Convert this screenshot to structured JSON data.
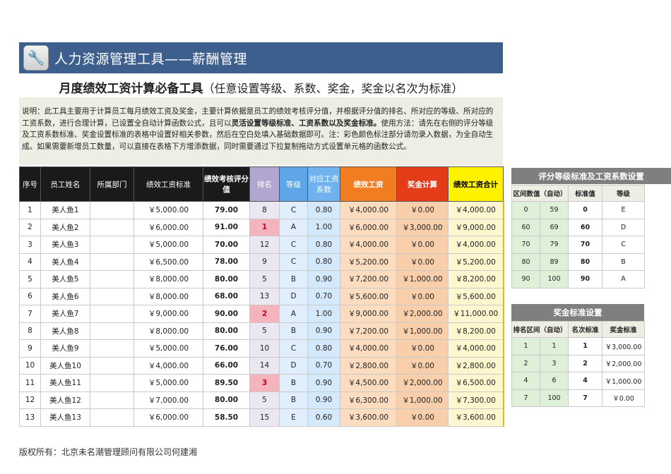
{
  "banner": {
    "icon": "wrench-icon",
    "title": "人力资源管理工具——薪酬管理"
  },
  "subtitle": {
    "main": "月度绩效工资计算必备工具",
    "note": "（任意设置等级、系数、奖金，奖金以名次为标准）"
  },
  "description": {
    "part1": "说明：此工具主要用于计算员工每月绩效工资及奖金，主要计算依据是员工的绩效考核评分值，并根据评分值的排名、所对应的等级、所对应的工资系数，进行合理计算，已设置全自动计算函数公式，且可以",
    "bold": "灵活设置等级标准、工资系数以及奖金标准。",
    "part2": "使用方法：请先在右侧的评分等级及工资系数标准、奖金设置标准的表格中设置好相关参数，然后在空白处填入基础数据即可。注：彩色颜色标注部分请勿录入数据，为全自动生成。如果需要新增员工数量，可以直接在表格下方增添数据，同时需要通过下拉复制拖动方式设置单元格的函数公式。"
  },
  "main_table": {
    "headers": [
      "序号",
      "员工姓名",
      "所属部门",
      "绩效工资标准",
      "绩效考核评分值",
      "排名",
      "等级",
      "对应工资系数",
      "绩效工资",
      "奖金计算",
      "绩效工资合计"
    ],
    "rows": [
      [
        "1",
        "美人鱼1",
        "",
        "￥5,000.00",
        "79.00",
        "8",
        "C",
        "0.80",
        "￥4,000.00",
        "￥0.00",
        "￥4,000.00"
      ],
      [
        "2",
        "美人鱼2",
        "",
        "￥6,000.00",
        "91.00",
        "1",
        "A",
        "1.00",
        "￥6,000.00",
        "￥3,000.00",
        "￥9,000.00"
      ],
      [
        "3",
        "美人鱼3",
        "",
        "￥5,000.00",
        "70.00",
        "12",
        "C",
        "0.80",
        "￥4,000.00",
        "￥0.00",
        "￥4,000.00"
      ],
      [
        "4",
        "美人鱼4",
        "",
        "￥6,500.00",
        "78.00",
        "9",
        "C",
        "0.80",
        "￥5,200.00",
        "￥0.00",
        "￥5,200.00"
      ],
      [
        "5",
        "美人鱼5",
        "",
        "￥8,000.00",
        "80.00",
        "5",
        "B",
        "0.90",
        "￥7,200.00",
        "￥1,000.00",
        "￥8,200.00"
      ],
      [
        "6",
        "美人鱼6",
        "",
        "￥8,000.00",
        "68.00",
        "13",
        "D",
        "0.70",
        "￥5,600.00",
        "￥0.00",
        "￥5,600.00"
      ],
      [
        "7",
        "美人鱼7",
        "",
        "￥9,000.00",
        "90.00",
        "2",
        "A",
        "1.00",
        "￥9,000.00",
        "￥2,000.00",
        "￥11,000.00"
      ],
      [
        "8",
        "美人鱼8",
        "",
        "￥8,000.00",
        "80.00",
        "5",
        "B",
        "0.90",
        "￥7,200.00",
        "￥1,000.00",
        "￥8,200.00"
      ],
      [
        "9",
        "美人鱼9",
        "",
        "￥5,000.00",
        "76.00",
        "10",
        "C",
        "0.80",
        "￥4,000.00",
        "￥0.00",
        "￥4,000.00"
      ],
      [
        "10",
        "美人鱼10",
        "",
        "￥4,000.00",
        "66.00",
        "14",
        "D",
        "0.70",
        "￥2,800.00",
        "￥0.00",
        "￥2,800.00"
      ],
      [
        "11",
        "美人鱼11",
        "",
        "￥5,000.00",
        "89.50",
        "3",
        "B",
        "0.90",
        "￥4,500.00",
        "￥2,000.00",
        "￥6,500.00"
      ],
      [
        "12",
        "美人鱼12",
        "",
        "￥7,000.00",
        "80.00",
        "5",
        "B",
        "0.90",
        "￥6,300.00",
        "￥1,000.00",
        "￥7,300.00"
      ],
      [
        "13",
        "美人鱼13",
        "",
        "￥6,000.00",
        "58.50",
        "15",
        "E",
        "0.60",
        "￥3,600.00",
        "￥0.00",
        "￥3,600.00"
      ]
    ]
  },
  "grade_table": {
    "title": "评分等级标准及工资系数设置",
    "headers": [
      "区间数值（自动）",
      "标准值",
      "等级"
    ],
    "rows": [
      [
        "0",
        "59",
        "0",
        "E"
      ],
      [
        "60",
        "69",
        "60",
        "D"
      ],
      [
        "70",
        "79",
        "70",
        "C"
      ],
      [
        "80",
        "89",
        "80",
        "B"
      ],
      [
        "90",
        "100",
        "90",
        "A"
      ]
    ]
  },
  "bonus_table": {
    "title": "奖金标准设置",
    "headers": [
      "排名区间（自动）",
      "名次标准",
      "奖金标准"
    ],
    "rows": [
      [
        "1",
        "1",
        "1",
        "￥3,000.00"
      ],
      [
        "2",
        "3",
        "2",
        "￥2,000.00"
      ],
      [
        "4",
        "6",
        "4",
        "￥1,000.00"
      ],
      [
        "7",
        "100",
        "7",
        "￥0.00"
      ]
    ]
  },
  "footer": "版权所有：北京未名潮管理顾问有限公司何建湘"
}
